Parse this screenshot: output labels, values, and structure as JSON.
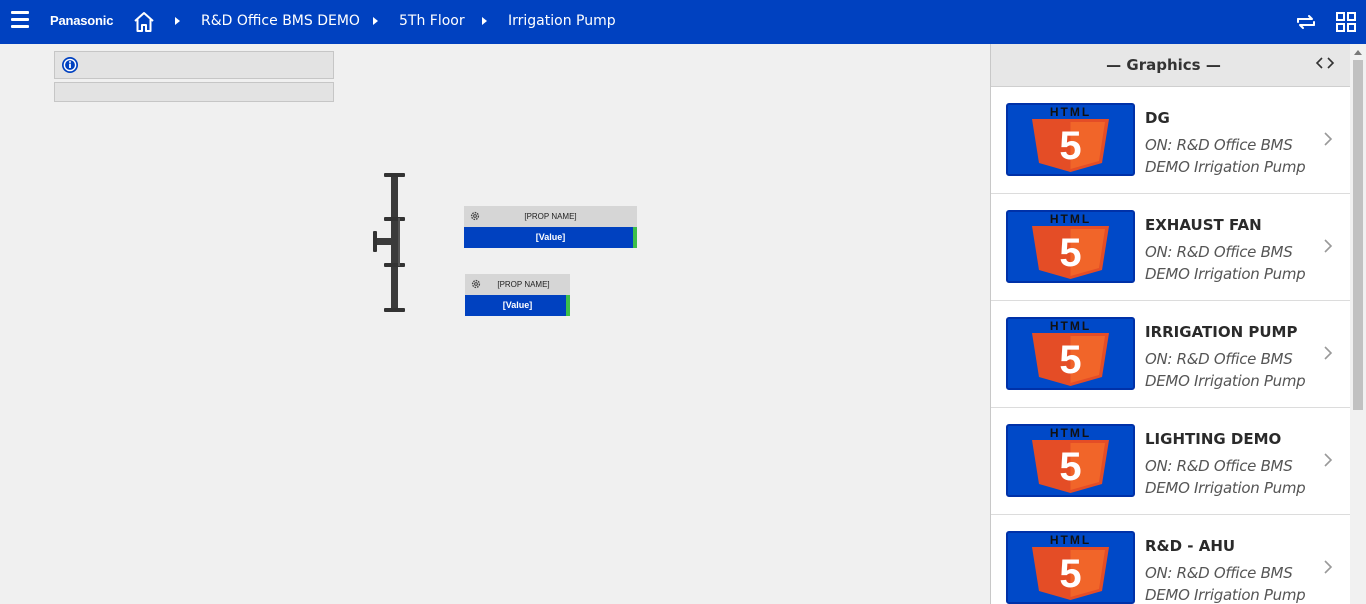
{
  "colors": {
    "brand": "#0041c0",
    "panel_header_bg": "#e7e7e7",
    "status_ok": "#3dbf4a",
    "html5_orange": "#e44d26"
  },
  "header": {
    "brand": "Panasonic",
    "breadcrumb": [
      {
        "label": "R&D Office BMS DEMO"
      },
      {
        "label": "5Th Floor"
      },
      {
        "label": "Irrigation Pump"
      }
    ],
    "icons": [
      "hamburger-menu-icon",
      "home-icon",
      "swap-arrows-icon",
      "grid-view-icon"
    ]
  },
  "canvas": {
    "prop_cards": [
      {
        "name": "[PROP NAME]",
        "value": "[Value]"
      },
      {
        "name": "[PROP NAME]",
        "value": "[Value]"
      }
    ]
  },
  "graphics_panel": {
    "title": "— Graphics —",
    "thumbnail_text": "HTML",
    "thumbnail_digit": "5",
    "items": [
      {
        "title": "DG",
        "subtitle": "ON: R&D Office BMS DEMO Irrigation Pump"
      },
      {
        "title": "EXHAUST FAN",
        "subtitle": "ON: R&D Office BMS DEMO Irrigation Pump"
      },
      {
        "title": "IRRIGATION PUMP",
        "subtitle": "ON: R&D Office BMS DEMO Irrigation Pump"
      },
      {
        "title": "LIGHTING DEMO",
        "subtitle": "ON: R&D Office BMS DEMO Irrigation Pump"
      },
      {
        "title": "R&D - AHU",
        "subtitle": "ON: R&D Office BMS DEMO Irrigation Pump"
      }
    ]
  }
}
